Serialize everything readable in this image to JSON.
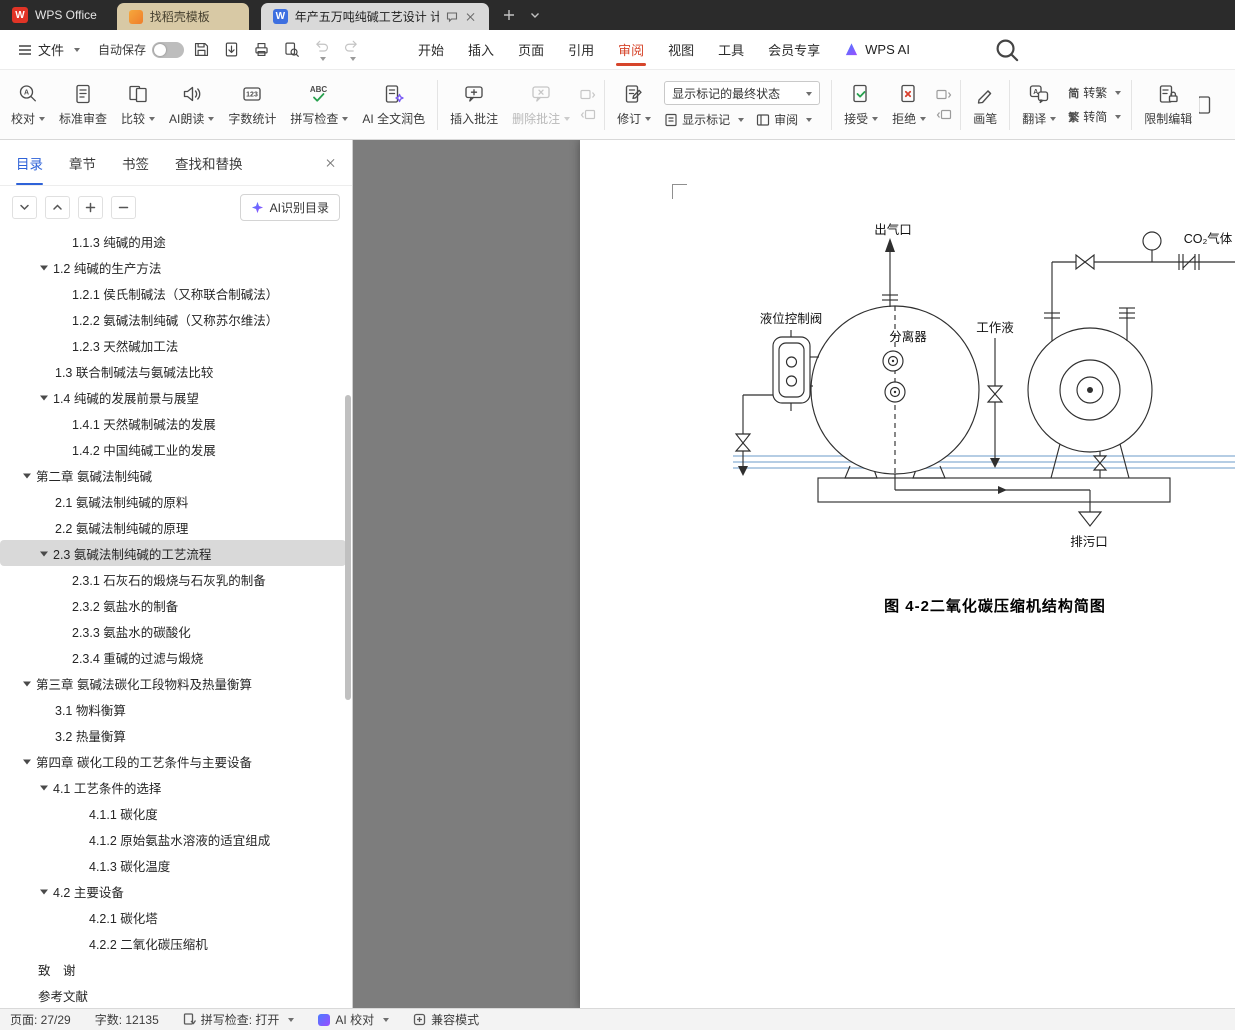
{
  "tabbar": {
    "app": "WPS Office",
    "template_tab": "找稻壳模板",
    "doc_tab": "年产五万吨纯碱工艺设计 计算"
  },
  "menubar": {
    "file": "文件",
    "autosave": "自动保存",
    "items": [
      "开始",
      "插入",
      "页面",
      "引用",
      "审阅",
      "视图",
      "工具",
      "会员专享"
    ],
    "active": "审阅",
    "wps_ai": "WPS AI"
  },
  "ribbon": {
    "proofread": "校对",
    "standard_review": "标准审查",
    "compare": "比较",
    "ai_read": "AI朗读",
    "word_count": "字数统计",
    "spell_check": "拼写检查",
    "ai_polish": "AI 全文润色",
    "insert_comment": "插入批注",
    "delete_comment": "删除批注",
    "track_changes": "修订",
    "markup_state": "显示标记的最终状态",
    "show_markup": "显示标记",
    "review": "审阅",
    "accept": "接受",
    "reject": "拒绝",
    "draw": "画笔",
    "translate": "翻译",
    "s2t": "转繁",
    "t2s": "转简",
    "restrict_edit": "限制编辑"
  },
  "icons": {
    "letter_a": "A",
    "abc": "ABC",
    "count": "123",
    "w": "W",
    "jian": "简",
    "fan": "繁"
  },
  "sidebar": {
    "tabs": [
      "目录",
      "章节",
      "书签",
      "查找和替换"
    ],
    "active_tab": "目录",
    "ai_recognize": "AI识别目录",
    "items": [
      {
        "t": "1.1.3 纯碱的用途",
        "lv": 2
      },
      {
        "t": "1.2 纯碱的生产方法",
        "lv": 1,
        "tri": true
      },
      {
        "t": "1.2.1 侯氏制碱法（又称联合制碱法）",
        "lv": 2
      },
      {
        "t": "1.2.2 氨碱法制纯碱（又称苏尔维法）",
        "lv": 2
      },
      {
        "t": "1.2.3 天然碱加工法",
        "lv": 2
      },
      {
        "t": "1.3 联合制碱法与氨碱法比较",
        "lv": 1
      },
      {
        "t": "1.4 纯碱的发展前景与展望",
        "lv": 1,
        "tri": true
      },
      {
        "t": "1.4.1 天然碱制碱法的发展",
        "lv": 2
      },
      {
        "t": "1.4.2 中国纯碱工业的发展",
        "lv": 2
      },
      {
        "t": "第二章 氨碱法制纯碱",
        "lv": 0,
        "tri": true
      },
      {
        "t": "2.1 氨碱法制纯碱的原料",
        "lv": 1
      },
      {
        "t": "2.2 氨碱法制纯碱的原理",
        "lv": 1
      },
      {
        "t": "2.3 氨碱法制纯碱的工艺流程",
        "lv": 1,
        "tri": true,
        "sel": true
      },
      {
        "t": "2.3.1 石灰石的煅烧与石灰乳的制备",
        "lv": 2
      },
      {
        "t": "2.3.2 氨盐水的制备",
        "lv": 2
      },
      {
        "t": "2.3.3 氨盐水的碳酸化",
        "lv": 2
      },
      {
        "t": "2.3.4 重碱的过滤与煅烧",
        "lv": 2
      },
      {
        "t": "第三章 氨碱法碳化工段物料及热量衡算",
        "lv": 0,
        "tri": true
      },
      {
        "t": "3.1 物料衡算",
        "lv": 1
      },
      {
        "t": "3.2 热量衡算",
        "lv": 1
      },
      {
        "t": "第四章 碳化工段的工艺条件与主要设备",
        "lv": 0,
        "tri": true
      },
      {
        "t": "4.1 工艺条件的选择",
        "lv": 1,
        "tri": true
      },
      {
        "t": "4.1.1 碳化度",
        "lv": 3
      },
      {
        "t": "4.1.2 原始氨盐水溶液的适宜组成",
        "lv": 3
      },
      {
        "t": "4.1.3 碳化温度",
        "lv": 3
      },
      {
        "t": "4.2 主要设备",
        "lv": 1,
        "tri": true
      },
      {
        "t": "4.2.1 碳化塔",
        "lv": 3
      },
      {
        "t": "4.2.2 二氧化碳压缩机",
        "lv": 3
      },
      {
        "t": "致　谢",
        "lv": 0
      },
      {
        "t": "参考文献",
        "lv": 0
      }
    ]
  },
  "document": {
    "labels": {
      "outlet": "出气口",
      "co2": "CO₂气体",
      "level_valve": "液位控制阀",
      "separator": "分离器",
      "working_fluid": "工作液",
      "drain": "排污口"
    },
    "caption": "图 4-2二氧化碳压缩机结构简图"
  },
  "statusbar": {
    "page": "页面: 27/29",
    "words": "字数: 12135",
    "spell": "拼写检查: 打开",
    "ai_proof": "AI 校对",
    "compat": "兼容模式"
  },
  "colors": {
    "accent_red": "#d6452b",
    "panel_tab_blue": "#2e62d8",
    "writer_blue": "#3d6fe0",
    "template_tab_beige": "#d8c9a5",
    "selection_gray": "#d9d9d9",
    "doc_bg_gray": "#7d7d7d",
    "accept_green": "#27a14e",
    "reject_red": "#d9402e",
    "ai_purple": "#7a5af5"
  }
}
